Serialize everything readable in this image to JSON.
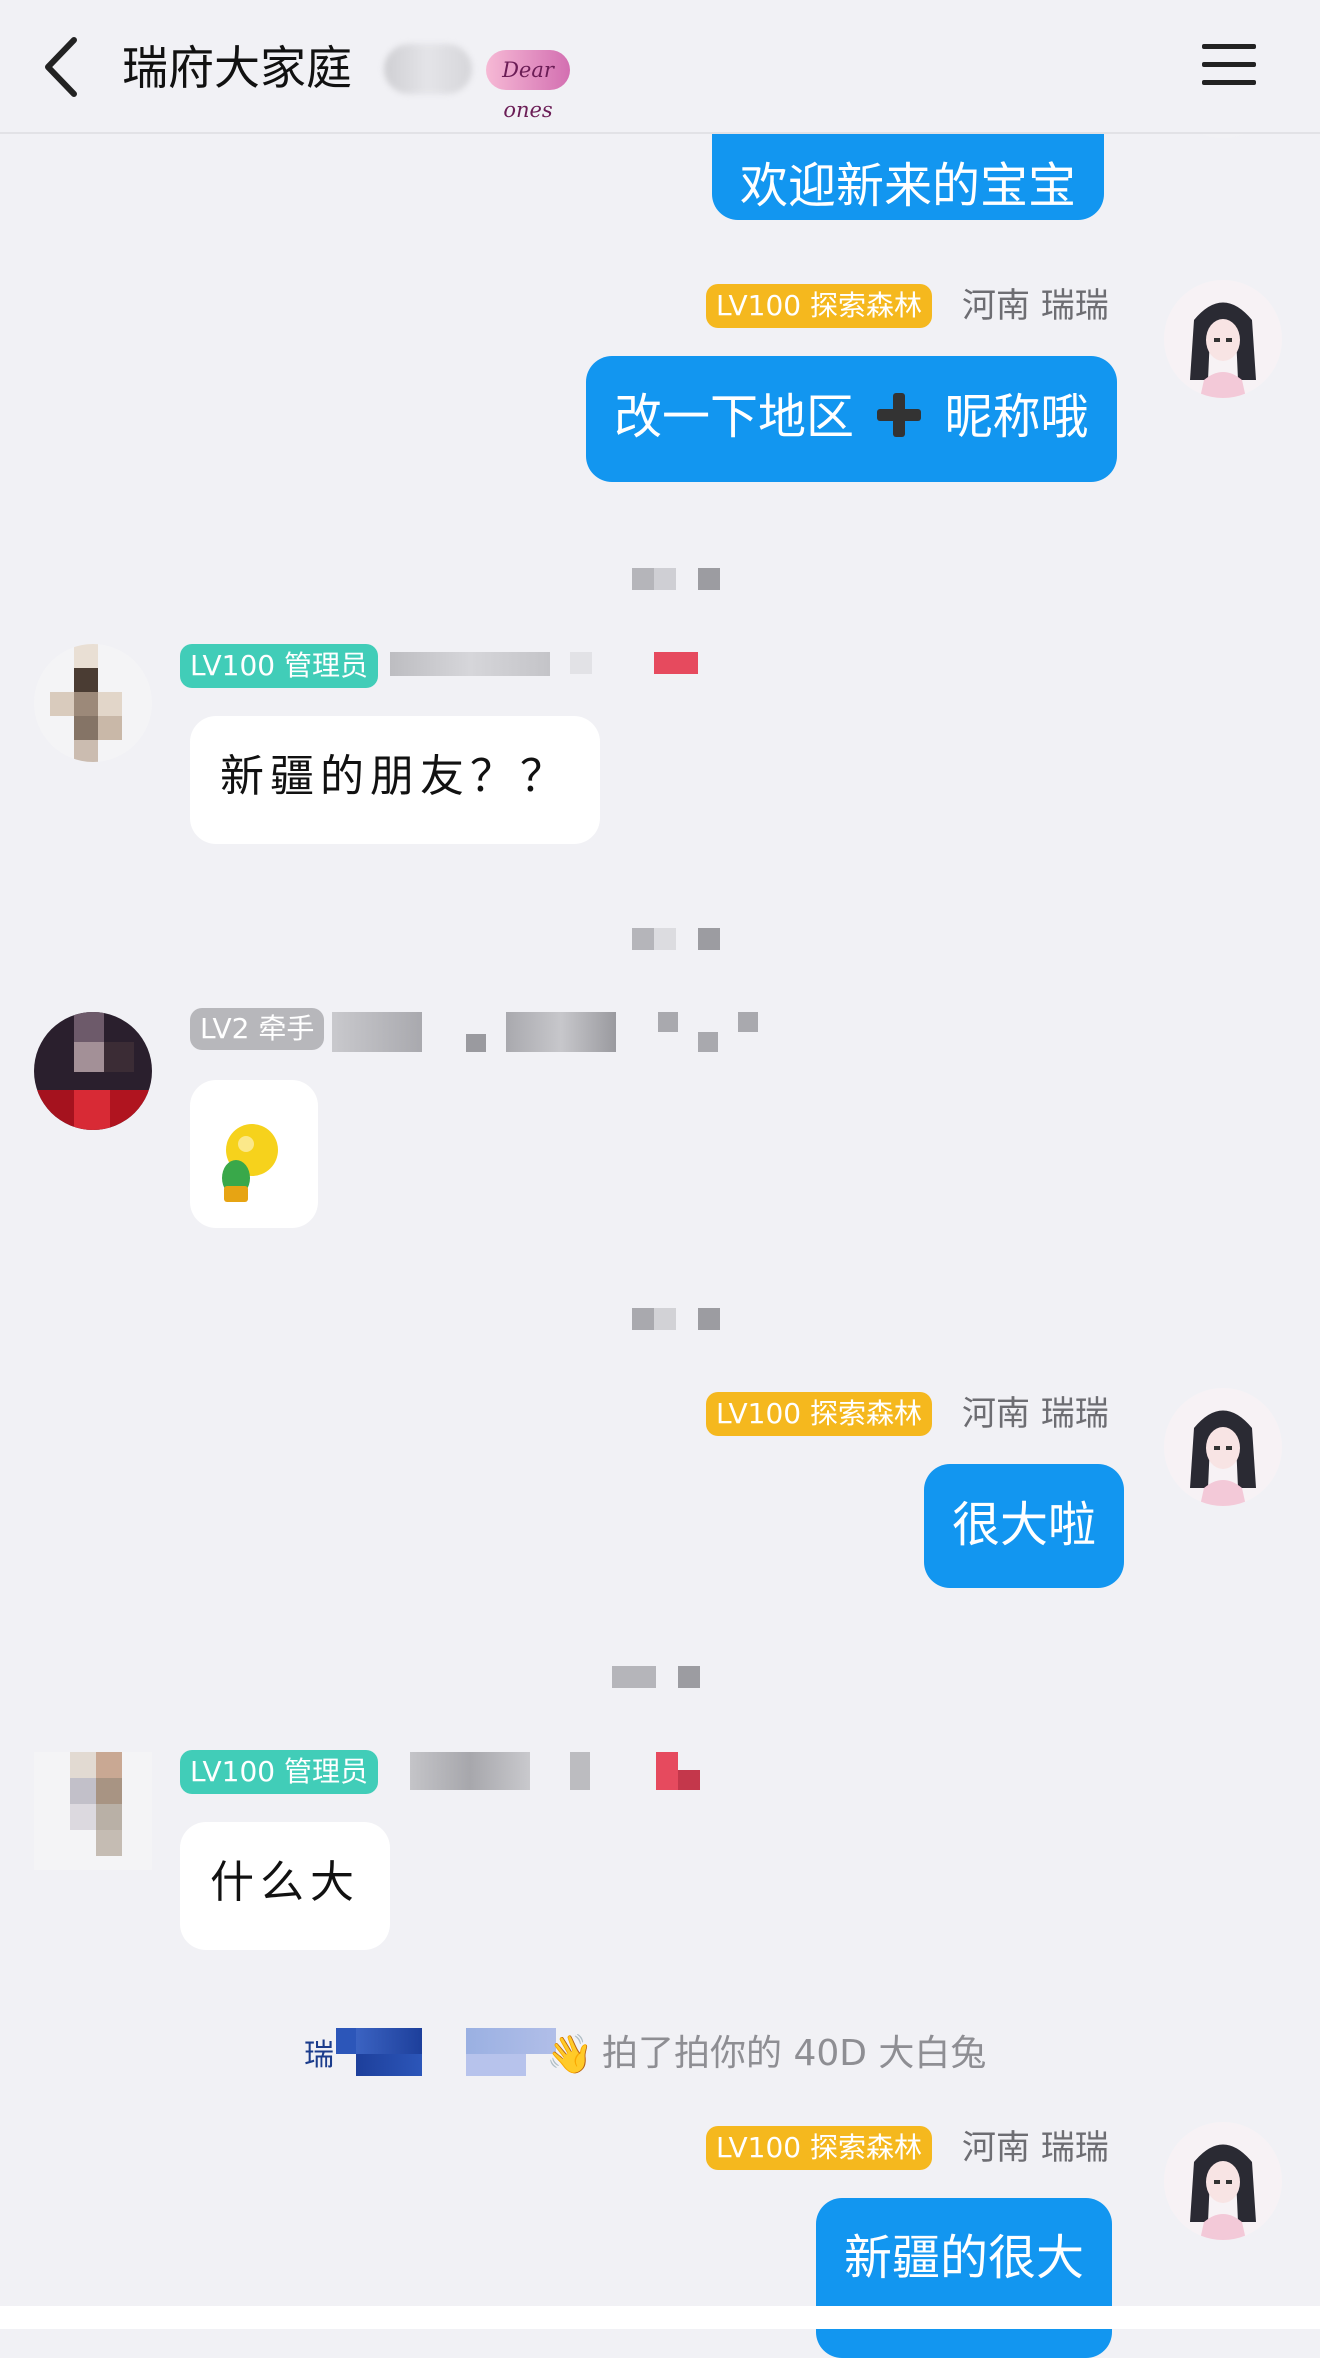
{
  "header": {
    "title": "瑞府大家庭",
    "badge_text": "Dear ones"
  },
  "messages": [
    {
      "side": "right",
      "text": "欢迎新来的宝宝"
    },
    {
      "side": "right",
      "tag": "LV100 探索森林",
      "name": "河南 瑞瑞",
      "text_a": "改一下地区",
      "text_b": "昵称哦"
    },
    {
      "side": "left",
      "tag": "LV100 管理员",
      "text": "新疆的朋友？？"
    },
    {
      "side": "left",
      "tag": "LV2 牵手",
      "sticker": "bulb-sticker"
    },
    {
      "side": "right",
      "tag": "LV100 探索森林",
      "name": "河南 瑞瑞",
      "text": "很大啦"
    },
    {
      "side": "left",
      "tag": "LV100 管理员",
      "text": "什么大"
    },
    {
      "side": "right",
      "tag": "LV100 探索森林",
      "name": "河南 瑞瑞",
      "text": "新疆的很大"
    }
  ],
  "system": {
    "name_prefix": "瑞",
    "emoji": "👋",
    "text": "拍了拍你的 40D 大白兔"
  },
  "colors": {
    "bubble_blue": "#1296f0",
    "tag_gold": "#f5b81e",
    "tag_teal": "#41cdb8",
    "background": "#f1f1f5"
  },
  "icons": [
    "back-icon",
    "menu-icon",
    "plus-icon",
    "bulb-sticker",
    "wave-icon"
  ]
}
